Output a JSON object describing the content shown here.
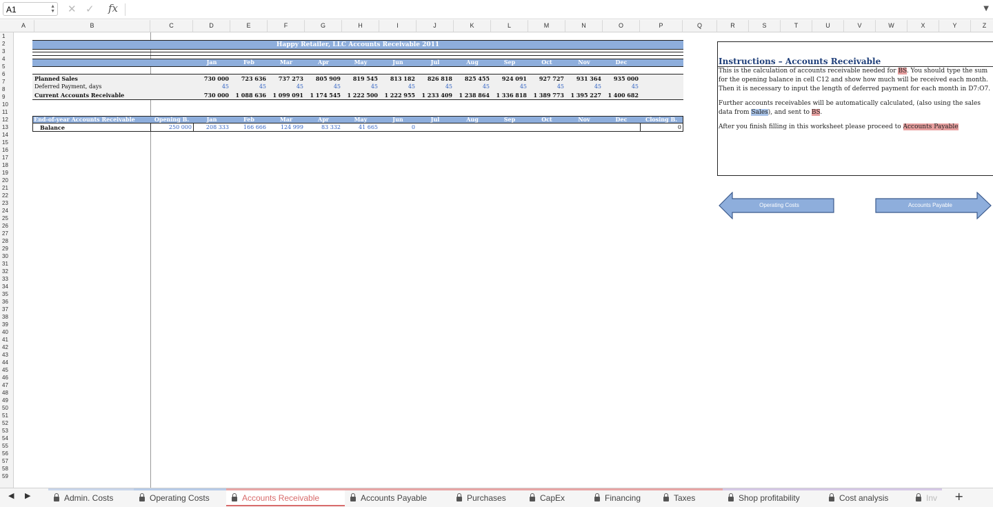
{
  "formula_bar": {
    "cell_ref": "A1",
    "fx": "fx",
    "cancel": "✕",
    "enter": "✓"
  },
  "columns": [
    "A",
    "B",
    "C",
    "D",
    "E",
    "F",
    "G",
    "H",
    "I",
    "J",
    "K",
    "L",
    "M",
    "N",
    "O",
    "P",
    "Q",
    "R",
    "S",
    "T",
    "U",
    "V",
    "W",
    "X",
    "Y",
    "Z"
  ],
  "rows": [
    "1",
    "2",
    "3",
    "4",
    "5",
    "6",
    "7",
    "8",
    "9",
    "10",
    "11",
    "12",
    "13",
    "14",
    "15",
    "16",
    "17",
    "18",
    "19",
    "20",
    "21",
    "22",
    "23",
    "24",
    "25",
    "26",
    "27",
    "28",
    "29",
    "30",
    "31",
    "32",
    "33",
    "34",
    "35",
    "36",
    "37",
    "38",
    "39",
    "40",
    "41",
    "42",
    "43",
    "44",
    "45",
    "46",
    "47",
    "48",
    "49",
    "50",
    "51",
    "52",
    "53",
    "54",
    "55",
    "56",
    "57",
    "58",
    "59"
  ],
  "sheet": {
    "title": "Happy Retailer, LLC Accounts Receivable 2011",
    "months": [
      "Jan",
      "Feb",
      "Mar",
      "Apr",
      "May",
      "Jun",
      "Jul",
      "Aug",
      "Sep",
      "Oct",
      "Nov",
      "Dec"
    ],
    "planned_sales_label": "Planned Sales",
    "planned_sales": [
      "730 000",
      "723 636",
      "737 273",
      "805 909",
      "819 545",
      "813 182",
      "826 818",
      "825 455",
      "924 091",
      "927 727",
      "931 364",
      "935 000"
    ],
    "deferred_label": "Deferred Payment, days",
    "deferred": [
      "45",
      "45",
      "45",
      "45",
      "45",
      "45",
      "45",
      "45",
      "45",
      "45",
      "45",
      "45"
    ],
    "current_ar_label": "Current Accounts Receivable",
    "current_ar": [
      "730 000",
      "1 088 636",
      "1 099 091",
      "1 174 545",
      "1 222 500",
      "1 222 955",
      "1 233 409",
      "1 238 864",
      "1 336 818",
      "1 389 773",
      "1 395 227",
      "1 400 682"
    ],
    "eoy_label": "End-of-year Accounts Receivable",
    "opening_label": "Opening B.",
    "closing_label": "Closing B.",
    "balance_label": "Balance",
    "opening_value": "250 000",
    "balance": [
      "208 333",
      "166 666",
      "124 999",
      "83 332",
      "41 665",
      "0",
      "",
      "",
      "",
      "",
      "",
      ""
    ],
    "closing_value": "0"
  },
  "instructions": {
    "title": "Instructions – Accounts Receivable",
    "p1_a": "This is the calculation of accounts receivable needed for ",
    "p1_bs": "BS",
    "p1_b": ". You should type the sum for the opening balance in cell C12 and show how much will be received each month. Then it is necessary to input the length of deferred payment for each month in D7:O7.",
    "p2_a": "Further accounts receivables will be automatically calculated, (also using the sales data from ",
    "p2_sales": "Sales",
    "p2_b": "), and sent to ",
    "p2_bs": "BS",
    "p2_c": ".",
    "p3_a": "After you finish filling in this worksheet please proceed to ",
    "p3_link": "Accounts Payable"
  },
  "nav_arrows": {
    "prev": "Operating Costs",
    "next": "Accounts Payable"
  },
  "tabs": [
    {
      "label": "Admin. Costs",
      "color": "#c9d5ea"
    },
    {
      "label": "Operating Costs",
      "color": "#b7cbe8"
    },
    {
      "label": "Accounts Receivable",
      "color": "#e8a5a5",
      "active": true
    },
    {
      "label": "Accounts Payable",
      "color": "#e8a5a5"
    },
    {
      "label": "Purchases",
      "color": "#e8a5a5"
    },
    {
      "label": "CapEx",
      "color": "#e8a5a5"
    },
    {
      "label": "Financing",
      "color": "#e8a5a5"
    },
    {
      "label": "Taxes",
      "color": "#e8a5a5"
    },
    {
      "label": "Shop profitability",
      "color": "#d5c8e6"
    },
    {
      "label": "Cost analysis",
      "color": "#d5c8e6"
    },
    {
      "label": "Inv",
      "color": "#d5c8e6"
    }
  ],
  "add_sheet": "+",
  "nav_prev": "◀",
  "nav_next": "▶",
  "colors": {
    "header_blue": "#8eaedc",
    "value_blue": "#3465c4",
    "highlight_red": "#e8a0a0",
    "highlight_blue": "#a8c3e8",
    "title_blue": "#1f3f7a"
  }
}
